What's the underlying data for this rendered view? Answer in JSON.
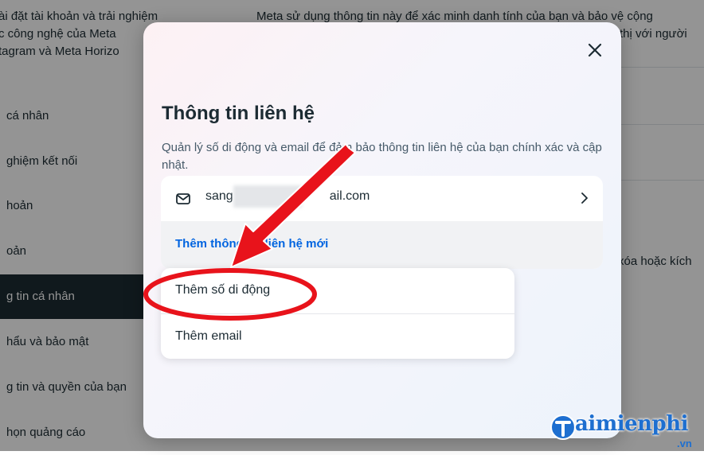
{
  "background": {
    "intro_lines": [
      "ài đặt tài khoản và trải nghiệm",
      "c công nghệ của Meta",
      "tagram và Meta Horizo"
    ],
    "nav_items": [
      {
        "label": "cá nhân"
      },
      {
        "label": "ghiệm kết nối"
      },
      {
        "label": "hoản"
      },
      {
        "label": "oản"
      },
      {
        "label": "g tin cá nhân"
      },
      {
        "label": "hẩu và bảo mật"
      },
      {
        "label": "g tin và quyền của bạn"
      },
      {
        "label": "họn quảng cáo"
      }
    ],
    "right_lines": [
      "Meta sử dụng thông tin này để xác minh danh tính của bạn và bảo vệ cộng",
      "thị với người"
    ],
    "right_snippet": "xóa hoặc kích"
  },
  "modal": {
    "title": "Thông tin liên hệ",
    "description": "Quản lý số di động và email để đảm bảo thông tin liên hệ của bạn chính xác và cập nhật.",
    "email_prefix": "sang",
    "email_suffix": "ail.com",
    "add_contact_label": "Thêm thông tin liên hệ mới",
    "dropdown": {
      "add_phone": "Thêm số di động",
      "add_email": "Thêm email"
    },
    "icons": {
      "close": "close-icon",
      "mail": "mail-icon",
      "chevron": "chevron-right-icon"
    }
  },
  "annotation": {
    "color": "#e8131b"
  },
  "watermark": {
    "brand": "aimienphi",
    "suffix": ".vn",
    "color": "#1e6fd0"
  }
}
